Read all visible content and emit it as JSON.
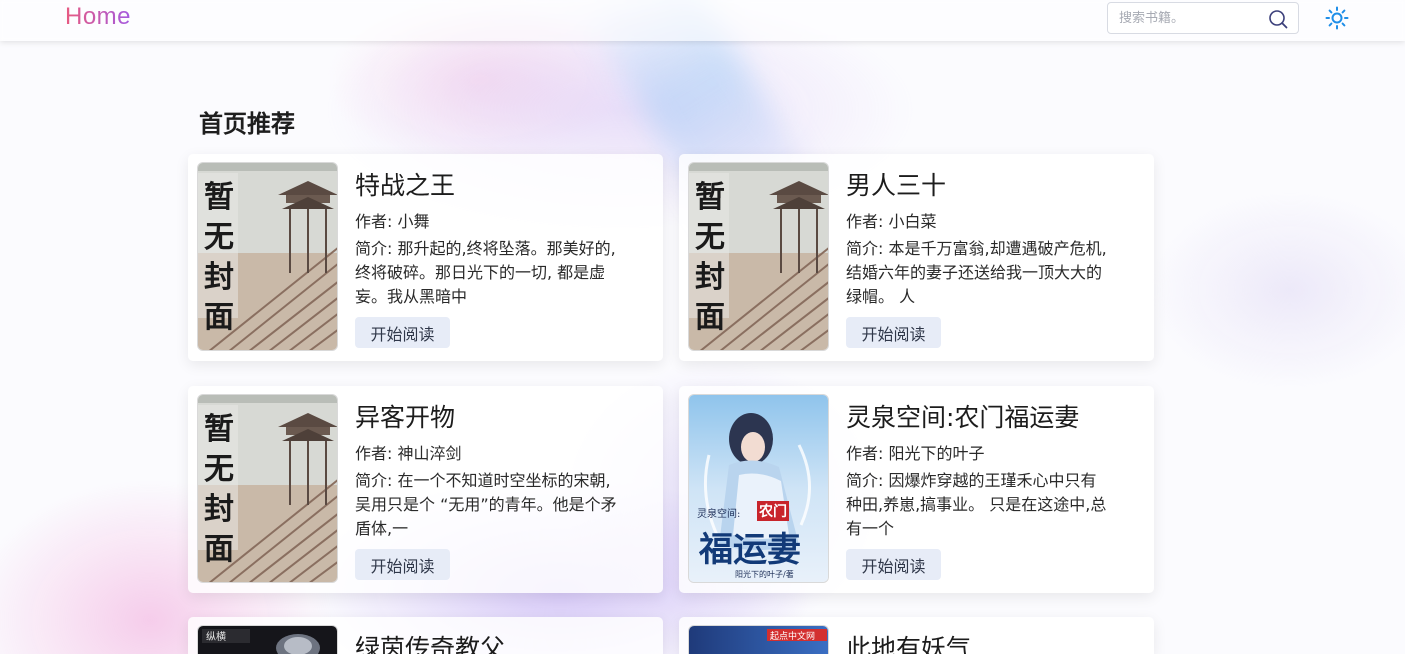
{
  "header": {
    "logo": "Home",
    "search_placeholder": "搜索书籍。"
  },
  "section": {
    "title": "首页推荐"
  },
  "labels": {
    "author_prefix": "作者:",
    "desc_prefix": "简介:",
    "read_button": "开始阅读"
  },
  "cover_placeholder": {
    "text_chars": [
      "暂",
      "无",
      "封",
      "面"
    ]
  },
  "books": [
    {
      "title": "特战之王",
      "author": "作者: 小舞",
      "desc": "简介:  那升起的,终将坠落。那美好的,终将破碎。那日光下的一切, 都是虚妄。我从黑暗中",
      "read": "开始阅读"
    },
    {
      "title": "男人三十",
      "author": "作者: 小白菜",
      "desc": "简介:  本是千万富翁,却遭遇破产危机,结婚六年的妻子还送给我一顶大大的绿帽。 人",
      "read": "开始阅读"
    },
    {
      "title": "异客开物",
      "author": "作者: 神山淬剑",
      "desc": "简介:  在一个不知道时空坐标的宋朝,吴用只是个 “无用”的青年。他是个矛盾体,一",
      "read": "开始阅读"
    },
    {
      "title": "灵泉空间:农门福运妻",
      "author": "作者: 阳光下的叶子",
      "desc": "简介:  因爆炸穿越的王瑾禾心中只有种田,养崽,搞事业。 只是在这途中,总有一个",
      "read": "开始阅读",
      "cover_text": {
        "top": "灵泉空间:",
        "seal": "农门",
        "big": "福运妻",
        "small": "阳光下的叶子/著"
      }
    },
    {
      "title": "绿茵传奇教父",
      "cover_text": {
        "brand": "纵横"
      }
    },
    {
      "title": "此地有妖气",
      "cover_text": {
        "brand": "起点中文网"
      }
    }
  ]
}
